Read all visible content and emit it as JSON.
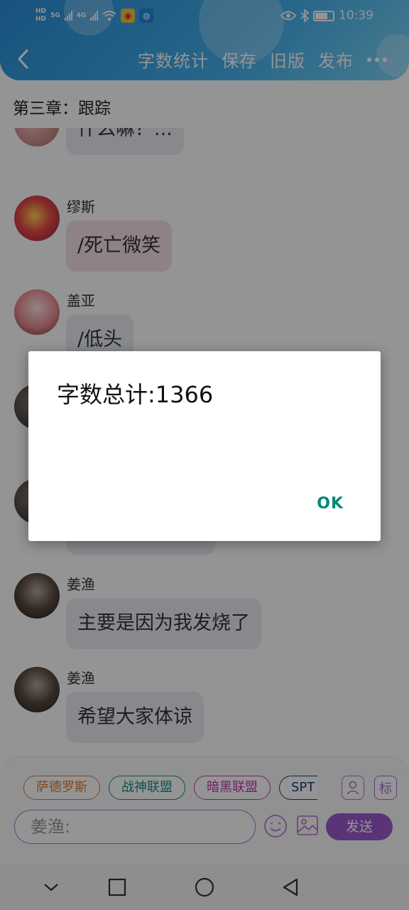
{
  "status_bar": {
    "left_labels": [
      "HD",
      "HD",
      "5G",
      "4G"
    ],
    "time": "10:39"
  },
  "header": {
    "actions": [
      "字数统计",
      "保存",
      "旧版",
      "发布"
    ],
    "more_icon": "more-dots-icon"
  },
  "chapter_title": "第三章：跟踪",
  "messages": [
    {
      "name": "",
      "text": "什么嘛？...",
      "style": "gray"
    },
    {
      "name": "缪斯",
      "text": "/死亡微笑",
      "style": "pink"
    },
    {
      "name": "盖亚",
      "text": "/低头",
      "style": "gray"
    },
    {
      "name": "",
      "text": "",
      "style": "gray"
    },
    {
      "name": "",
      "text": "",
      "style": "gray"
    },
    {
      "name": "姜渔",
      "text": "主要是因为我发烧了",
      "style": "gray"
    },
    {
      "name": "姜渔",
      "text": "希望大家体谅",
      "style": "gray"
    }
  ],
  "composer": {
    "tags": [
      "萨德罗斯",
      "战神联盟",
      "暗黑联盟",
      "SPT"
    ],
    "person_icon": "person-icon",
    "tag_button": "标",
    "input_value": "姜渔:",
    "send_label": "发送"
  },
  "dialog": {
    "message": "字数总计:1366",
    "ok_label": "OK"
  },
  "colors": {
    "header": "#43b0ec",
    "accent": "#9b59cf",
    "ok_text": "#00897b"
  }
}
